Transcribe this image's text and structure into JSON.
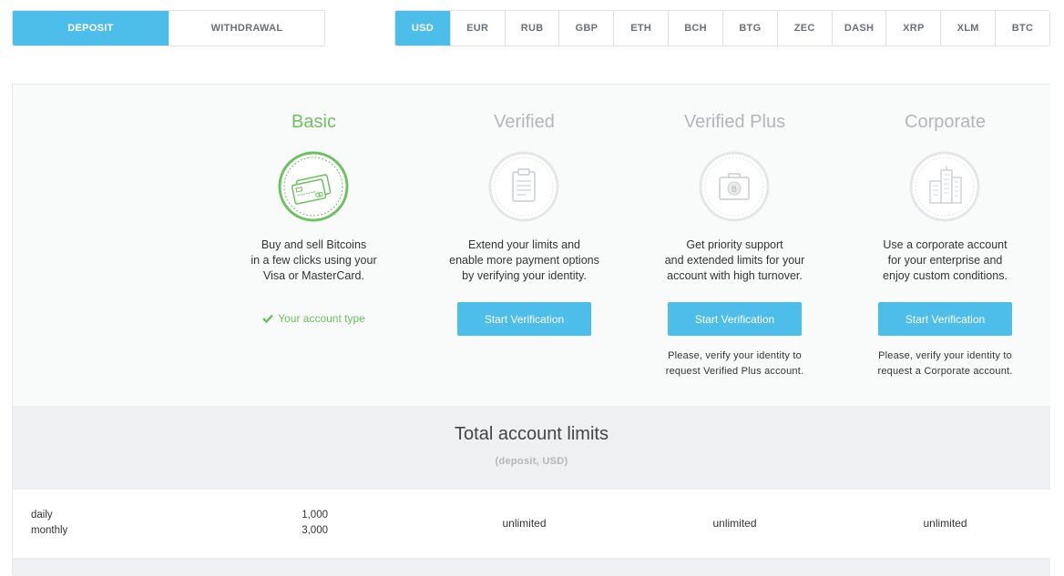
{
  "mode_tabs": [
    {
      "label": "DEPOSIT",
      "active": true
    },
    {
      "label": "WITHDRAWAL",
      "active": false
    }
  ],
  "currencies": [
    {
      "label": "USD",
      "active": true
    },
    {
      "label": "EUR"
    },
    {
      "label": "RUB"
    },
    {
      "label": "GBP"
    },
    {
      "label": "ETH"
    },
    {
      "label": "BCH"
    },
    {
      "label": "BTG"
    },
    {
      "label": "ZEC"
    },
    {
      "label": "DASH"
    },
    {
      "label": "XRP"
    },
    {
      "label": "XLM"
    },
    {
      "label": "BTC"
    }
  ],
  "tiers": {
    "basic": {
      "title": "Basic",
      "icon": "credit-cards-icon",
      "desc_lines": [
        "Buy and sell Bitcoins",
        "in a few clicks using your",
        "Visa or MasterCard."
      ],
      "status": "Your account type"
    },
    "verified": {
      "title": "Verified",
      "icon": "clipboard-icon",
      "desc_lines": [
        "Extend your limits and",
        "enable more payment options",
        "by verifying your identity."
      ],
      "button": "Start Verification"
    },
    "verified_plus": {
      "title": "Verified Plus",
      "icon": "bitcoin-briefcase-icon",
      "desc_lines": [
        "Get priority support",
        "and extended limits for your",
        "account with high turnover."
      ],
      "button": "Start Verification",
      "note_lines": [
        "Please, verify your identity to",
        "request Verified Plus account."
      ]
    },
    "corporate": {
      "title": "Corporate",
      "icon": "buildings-icon",
      "desc_lines": [
        "Use a corporate account",
        "for your enterprise and",
        "enjoy custom conditions."
      ],
      "button": "Start Verification",
      "note_lines": [
        "Please, verify your identity to",
        "request a Corporate account."
      ]
    }
  },
  "limits": {
    "title": "Total account limits",
    "subtitle": "(deposit, USD)",
    "row_labels": [
      "daily",
      "monthly"
    ],
    "basic_values": [
      "1,000",
      "3,000"
    ],
    "verified_value": "unlimited",
    "verified_plus_value": "unlimited",
    "corporate_value": "unlimited"
  },
  "colors": {
    "accent": "#4dbde9",
    "basic_green": "#6cc25e",
    "muted": "#b3b7ba"
  }
}
